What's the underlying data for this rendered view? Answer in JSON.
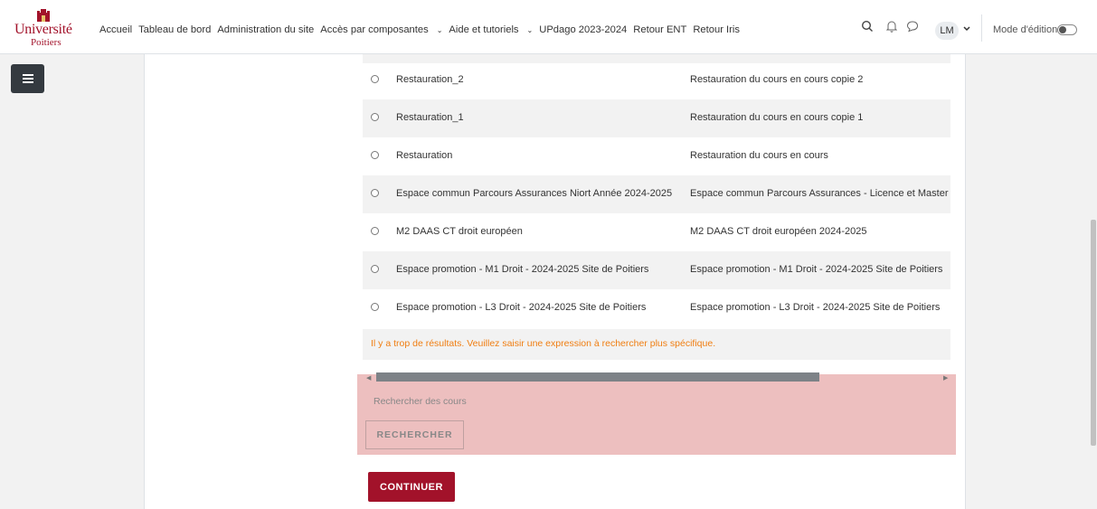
{
  "logo": {
    "line1": "Université",
    "line2": "Poitiers"
  },
  "nav": {
    "links": [
      "Accueil",
      "Tableau de bord",
      "Administration du site",
      "Accès par composantes",
      "Aide et tutoriels",
      "UPdago 2023-2024",
      "Retour ENT",
      "Retour Iris"
    ],
    "user_initials": "LM",
    "edit_mode_label": "Mode d'édition",
    "edit_mode_on": false
  },
  "results": [
    {
      "name": "Restauration_2",
      "description": "Restauration du cours en cours copie 2"
    },
    {
      "name": "Restauration_1",
      "description": "Restauration du cours en cours copie 1"
    },
    {
      "name": "Restauration",
      "description": "Restauration du cours en cours"
    },
    {
      "name": "Espace commun Parcours Assurances Niort Année 2024-2025",
      "description": "Espace commun Parcours Assurances - Licence et Master -"
    },
    {
      "name": "M2 DAAS CT droit européen",
      "description": "M2 DAAS CT droit européen 2024-2025"
    },
    {
      "name": "Espace promotion - M1 Droit - 2024-2025 Site de Poitiers",
      "description": "Espace promotion - M1 Droit - 2024-2025 Site de Poitiers"
    },
    {
      "name": "Espace promotion - L3 Droit - 2024-2025 Site de Poitiers",
      "description": "Espace promotion - L3 Droit - 2024-2025 Site de Poitiers"
    }
  ],
  "warning": "Il y a trop de résultats. Veuillez saisir une expression à rechercher plus spécifique.",
  "search": {
    "placeholder": "Rechercher des cours",
    "button_label": "RECHERCHER"
  },
  "continue_label": "CONTINUER",
  "colors": {
    "brand": "#a2122a",
    "warning": "#f07e12",
    "panel": "#edbfbf"
  },
  "icons": [
    "crest-logo",
    "chevron-down-icon",
    "search-icon",
    "bell-icon",
    "chat-icon",
    "hamburger-icon"
  ]
}
